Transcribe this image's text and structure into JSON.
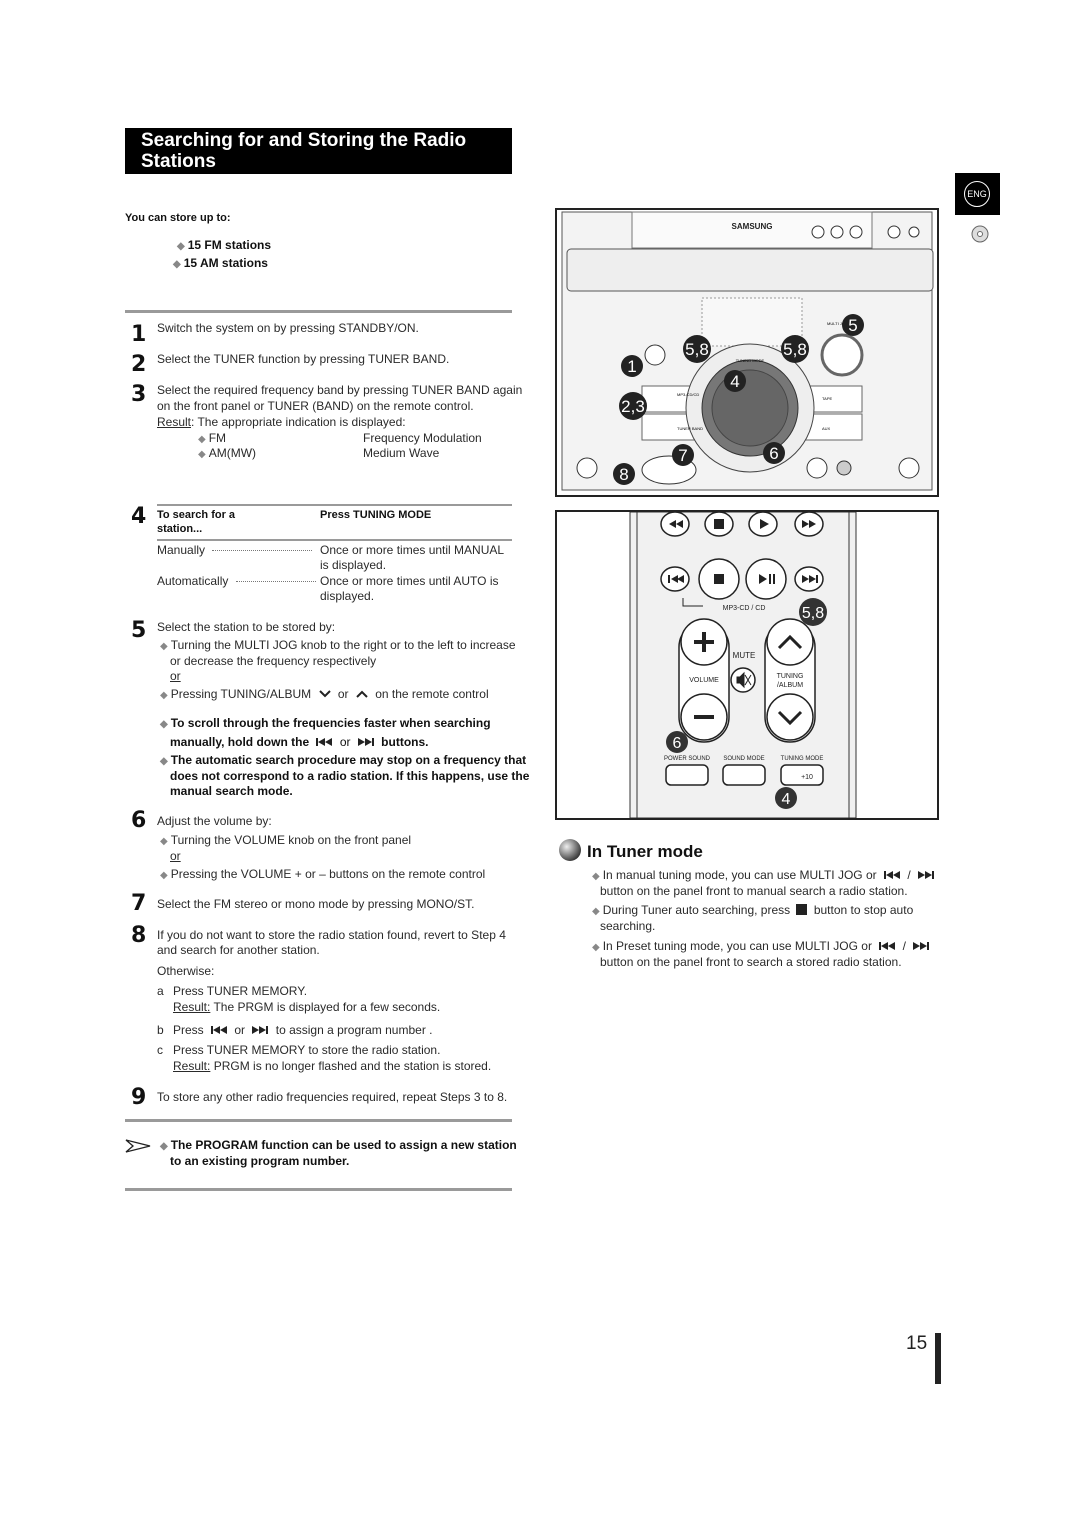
{
  "title": {
    "line1": "Searching for and Storing the Radio",
    "line2": "Stations"
  },
  "lang_tab": "ENG",
  "store": {
    "heading": "You can store up to:",
    "items": [
      "15 FM stations",
      "15 AM stations"
    ]
  },
  "steps": {
    "s1": {
      "n": "1",
      "text": "Switch the system on by pressing STANDBY/ON."
    },
    "s2": {
      "n": "2",
      "text": "Select the TUNER function by pressing TUNER BAND."
    },
    "s3": {
      "n": "3",
      "line1": "Select the required frequency band by pressing TUNER BAND  again",
      "line2": "on the front panel or TUNER (BAND)  on the remote control.",
      "result_label": "Result",
      "result_text": ": The appropriate indication is displayed:",
      "bands": [
        {
          "code": "FM",
          "desc": "Frequency Modulation"
        },
        {
          "code": "AM(MW)",
          "desc": "Medium Wave"
        }
      ]
    },
    "s4": {
      "n": "4",
      "col1_head_1": "To search for a",
      "col1_head_2": "station...",
      "col2_head": "Press TUNING MODE",
      "rows": [
        {
          "mode": "Manually",
          "l1": "Once or more times until MANUAL",
          "l2": "is displayed."
        },
        {
          "mode": "Automatically",
          "l1": "Once or more times until AUTO   is",
          "l2": "displayed."
        }
      ]
    },
    "s5": {
      "n": "5",
      "text": "Select the station to be stored by:",
      "b1_l1": "Turning the MULTI JOG  knob to the right or to the left to increase",
      "b1_l2": "or decrease the frequency respectively",
      "or": "or",
      "b2_pre": "Pressing TUNING/ALBUM",
      "b2_mid": "or",
      "b2_post": "on the remote control",
      "n1_l1": "To scroll through the frequencies faster when searching",
      "n1_pre": "manually, hold down the",
      "n1_mid": "or",
      "n1_post": "buttons.",
      "n2_l1": "The automatic search procedure may stop on a frequency that",
      "n2_l2": "does not correspond to a radio station. If this happens, use the",
      "n2_l3": "manual search mode."
    },
    "s6": {
      "n": "6",
      "text": "Adjust the volume by:",
      "b1": "Turning the VOLUME knob on the front panel",
      "or": "or",
      "b2": "Pressing the VOLUME + or – buttons on the remote control"
    },
    "s7": {
      "n": "7",
      "text": "Select the FM stereo or mono mode by pressing MONO/ST."
    },
    "s8": {
      "n": "8",
      "l1": "If you do not want to store the radio station found, revert to Step 4",
      "l2": "and search for another station.",
      "otherwise": "Otherwise:",
      "a_letter": "a",
      "a_text": "Press TUNER MEMORY.",
      "a_res_label": "Result:",
      "a_res": " The PRGM  is displayed for a few seconds.",
      "b_letter": "b",
      "b_pre": "Press",
      "b_mid": "or",
      "b_post": "to assign a program number .",
      "c_letter": "c",
      "c_text": "Press TUNER MEMORY to store the radio station.",
      "c_res_label": "Result:",
      "c_res": " PRGM  is no longer flashed and the station is stored."
    },
    "s9": {
      "n": "9",
      "text": "To store any other radio frequencies required, repeat Steps 3 to 8."
    }
  },
  "note": {
    "l1": "The PROGRAM function can be used to assign a new station",
    "l2": "to an existing program number."
  },
  "device": {
    "brand": "SAMSUNG",
    "callouts": [
      "5",
      "5,8",
      "5,8",
      "1",
      "4",
      "2,3",
      "7",
      "6",
      "8"
    ],
    "labels": {
      "multi_jog": "MULTI JOG",
      "tuning_mode": "TUNING MODE",
      "mp3": "MP3-CD/CD",
      "tape": "TAPE",
      "tuner_band": "TUNER BAND",
      "aux": "AUX"
    }
  },
  "remote": {
    "mp3_label": "MP3-CD / CD",
    "mute": "MUTE",
    "volume": "VOLUME",
    "tuning_l1": "TUNING",
    "tuning_l2": "/ALBUM",
    "power_sound": "POWER SOUND",
    "sound_mode": "SOUND MODE",
    "tuning_mode": "TUNING MODE",
    "plus10": "+10",
    "callouts": [
      "5,8",
      "6",
      "4"
    ]
  },
  "tuner_mode": {
    "title": "In Tuner mode",
    "b1_pre": "In manual tuning mode, you can use MULTI JOG  or",
    "b1_sep": "/",
    "b1_l2": "button on the panel front to manual search a radio station.",
    "b2_pre": "During Tuner auto searching, press",
    "b2_post": "button to stop auto",
    "b2_l2": "searching.",
    "b3_pre": "In Preset tuning mode, you can use MULTI JOG  or",
    "b3_sep": "/",
    "b3_l2": "button on the panel front to search a stored radio station."
  },
  "page_number": "15"
}
